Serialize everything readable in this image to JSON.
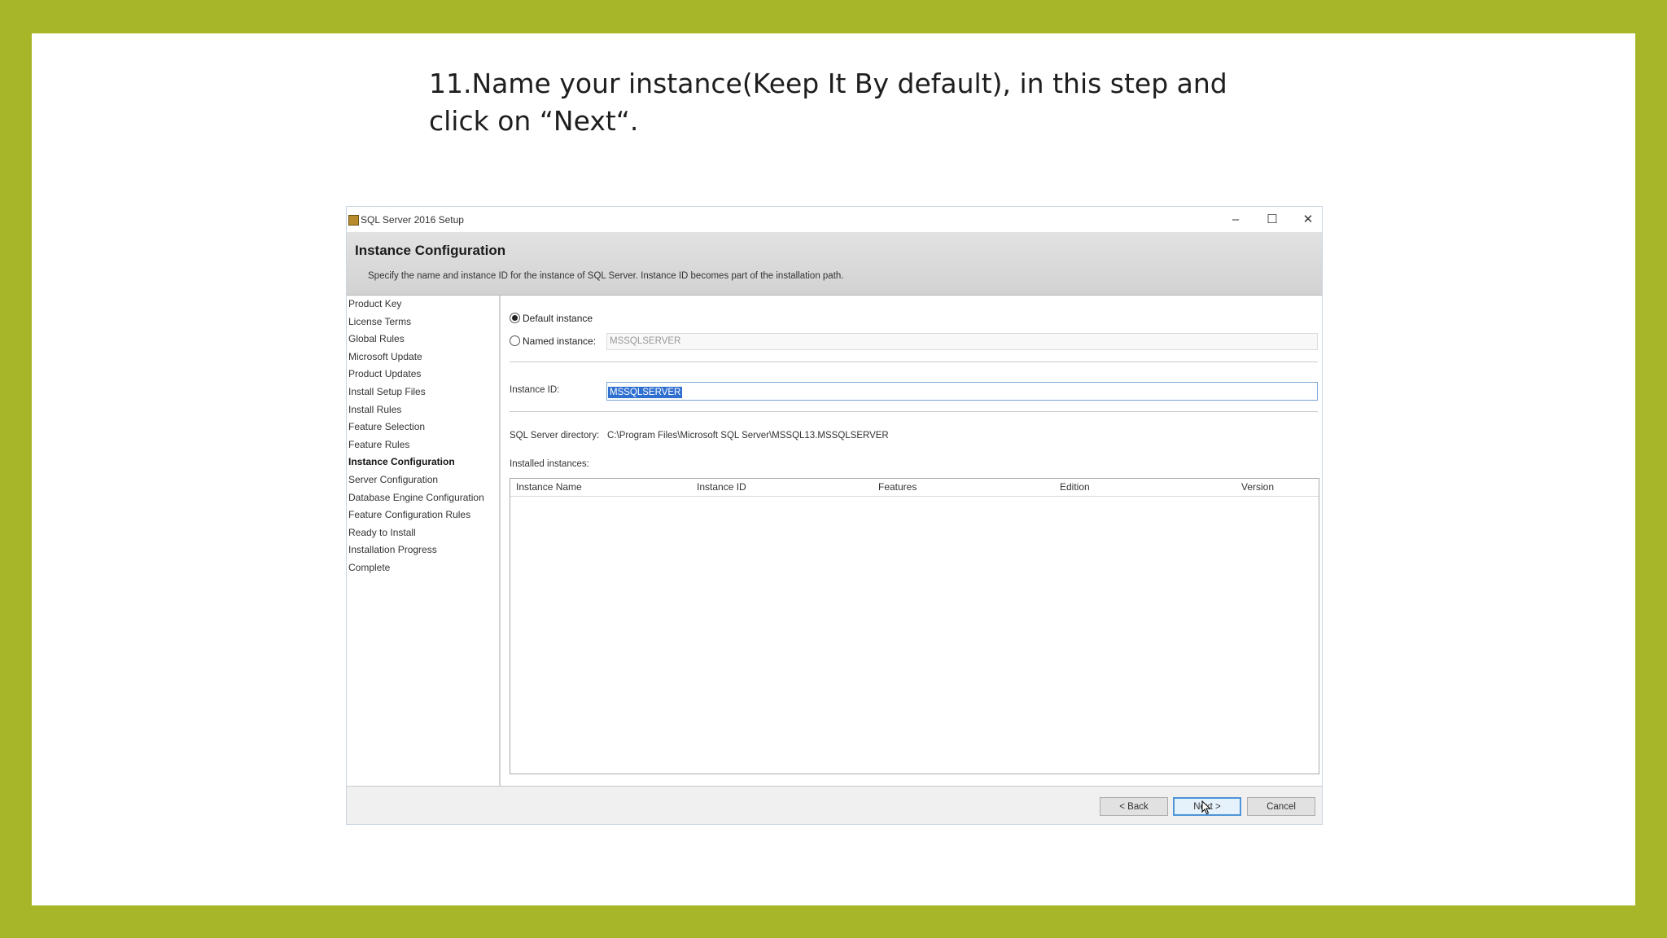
{
  "caption": {
    "line1": "11.Name your instance(Keep It By default), in this step and",
    "line2": "click on “Next“."
  },
  "window": {
    "title": "SQL Server 2016 Setup",
    "controls": {
      "minimize": "–",
      "maximize": "☐",
      "close": "✕"
    }
  },
  "header": {
    "title": "Instance Configuration",
    "description": "Specify the name and instance ID for the instance of SQL Server. Instance ID becomes part of the installation path."
  },
  "steps": [
    "Product Key",
    "License Terms",
    "Global Rules",
    "Microsoft Update",
    "Product Updates",
    "Install Setup Files",
    "Install Rules",
    "Feature Selection",
    "Feature Rules",
    "Instance Configuration",
    "Server Configuration",
    "Database Engine Configuration",
    "Feature Configuration Rules",
    "Ready to Install",
    "Installation Progress",
    "Complete"
  ],
  "form": {
    "default_instance_label": "Default instance",
    "named_instance_label": "Named instance:",
    "named_instance_value": "MSSQLSERVER",
    "instance_id_label": "Instance ID:",
    "instance_id_value": "MSSQLSERVER",
    "directory_label": "SQL Server directory:",
    "directory_value": "C:\\Program Files\\Microsoft SQL Server\\MSSQL13.MSSQLSERVER",
    "installed_label": "Installed instances:"
  },
  "grid": {
    "columns": [
      "Instance Name",
      "Instance ID",
      "Features",
      "Edition",
      "Version"
    ]
  },
  "buttons": {
    "back": "< Back",
    "next": "Next >",
    "cancel": "Cancel"
  }
}
